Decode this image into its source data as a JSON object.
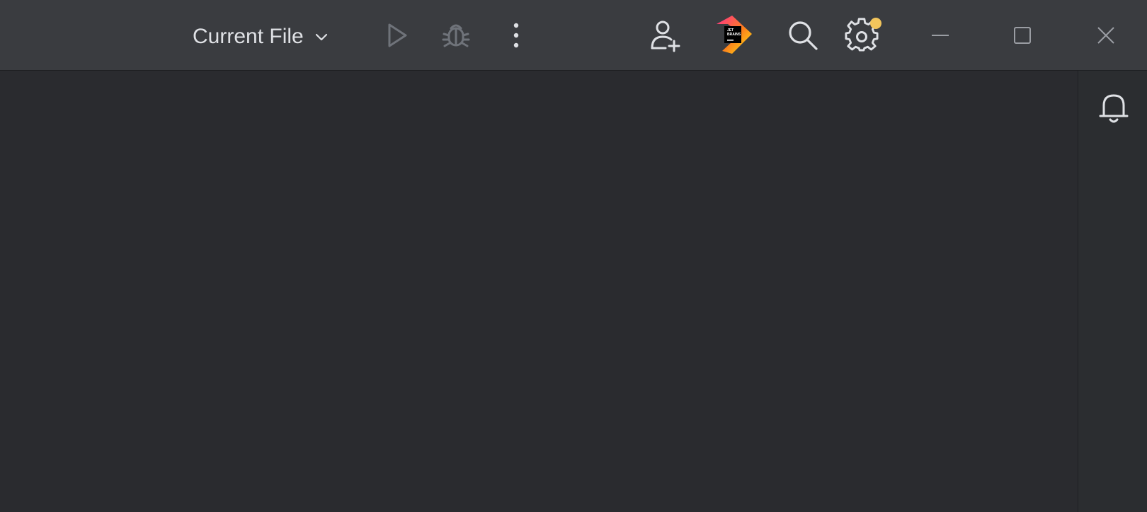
{
  "titlebar": {
    "run_config_label": "Current File",
    "icons": {
      "run": "play-icon",
      "debug": "bug-icon",
      "more": "more-vertical-icon",
      "add_user": "add-user-icon",
      "jetbrains_logo": "jetbrains-logo-icon",
      "search": "search-icon",
      "settings": "gear-icon",
      "minimize": "minimize-icon",
      "maximize": "maximize-icon",
      "close": "close-icon"
    },
    "settings_badge_color": "#f2c55c"
  },
  "right_toolbar": {
    "notifications_icon": "bell-icon"
  },
  "colors": {
    "titlebar_bg": "#3a3c40",
    "editor_bg": "#2a2b2f",
    "icon_fg": "#dfe1e5",
    "icon_disabled": "#6f737a"
  }
}
